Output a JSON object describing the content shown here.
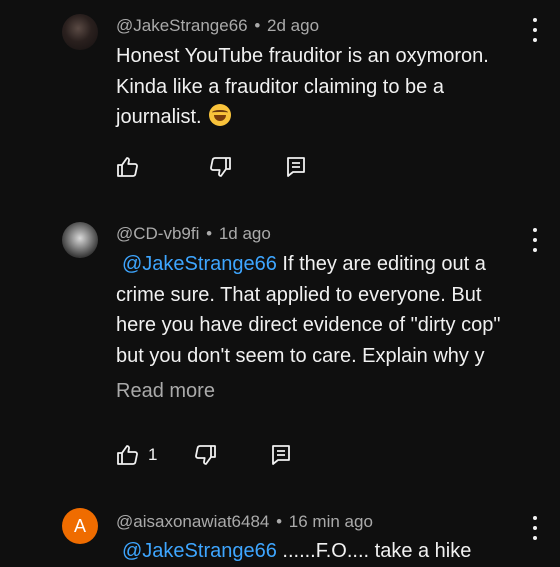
{
  "comments": [
    {
      "author": "@JakeStrange66",
      "separator": "•",
      "time": "2d ago",
      "text": "Honest YouTube frauditor is an oxymoron. Kinda like a frauditor claiming to be a journalist.",
      "emoji": "laughing-tears",
      "like_count": ""
    },
    {
      "author": "@CD-vb9fi",
      "separator": "•",
      "time": "1d ago",
      "mention": "@JakeStrange66",
      "text": " If they are editing out a crime sure.  That applied to everyone.  But here you have direct evidence of \"dirty cop\" but you don't seem to care.  Explain why y",
      "read_more": "Read more",
      "like_count": "1"
    },
    {
      "author": "@aisaxonawiat6484",
      "separator": "•",
      "time": "16 min ago",
      "avatar_letter": "A",
      "mention": "@JakeStrange66",
      "text": " ......F.O.... take a hike",
      "like_count": ""
    }
  ],
  "icons": {
    "like": "thumb-up-icon",
    "dislike": "thumb-down-icon",
    "reply": "reply-icon",
    "more": "more-vert-icon"
  },
  "colors": {
    "background": "#0f0f0f",
    "text": "#f1f1f1",
    "secondary": "#aaaaaa",
    "mention": "#3ea6ff",
    "avatar_letter_bg": "#ef6c00"
  }
}
